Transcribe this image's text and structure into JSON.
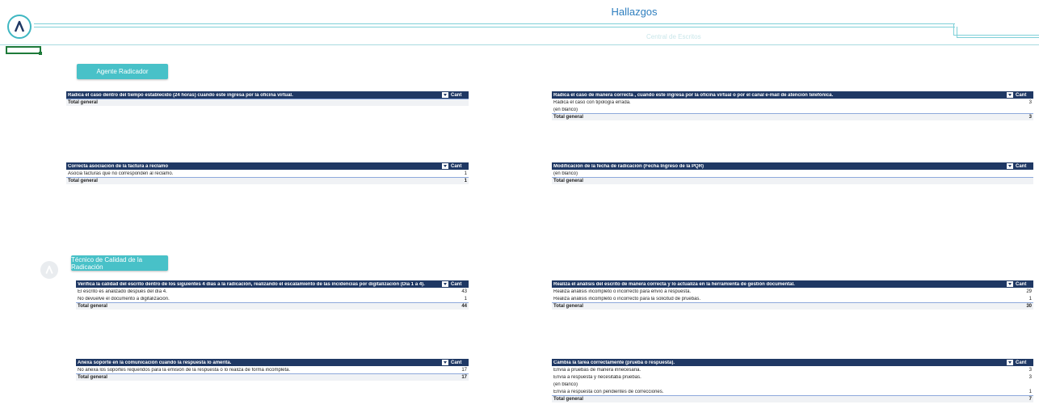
{
  "header": {
    "title": "Hallazgos",
    "subtitle": "Central de Escritos"
  },
  "sections": {
    "agente": "Agente Radicador",
    "tecnico": "Técnico de Calidad de la Radicación"
  },
  "tables": [
    {
      "header": "Radica el caso dentro del tiempo establecido (24 horas) cuando este ingresa por la oficina virtual.",
      "count_label": "Cant",
      "rows": [],
      "total_label": "Total general",
      "total": ""
    },
    {
      "header": "Radica el caso de manera correcta , cuando este ingresa por la oficina virtual o por el canal e-mail de atención telefónica.",
      "count_label": "Cant",
      "rows": [
        {
          "label": "Radica el caso con tipología errada.",
          "value": "3"
        },
        {
          "label": "(en blanco)",
          "value": ""
        }
      ],
      "total_label": "Total general",
      "total": "3"
    },
    {
      "header": "Correcta asociación de la factura a reclamo",
      "count_label": "Cant",
      "rows": [
        {
          "label": "Asocia facturas que no corresponden al reclamo.",
          "value": "1"
        }
      ],
      "total_label": "Total general",
      "total": "1"
    },
    {
      "header": "Modificación de la fecha de radicación (Fecha Ingreso de la PQR)",
      "count_label": "Cant",
      "rows": [
        {
          "label": "(en blanco)",
          "value": ""
        }
      ],
      "total_label": "Total general",
      "total": ""
    },
    {
      "header": "Verifica la calidad del escrito dentro de los siguientes 4 días a la radicación, realizando el escalamiento de las incidencias por digitalización (Día 1 a 4).",
      "count_label": "Cant",
      "rows": [
        {
          "label": "El escrito es analizado después del día 4.",
          "value": "43"
        },
        {
          "label": "No devuelve el documento a digitalización.",
          "value": "1"
        }
      ],
      "total_label": "Total general",
      "total": "44"
    },
    {
      "header": "Realiza el análisis del escrito de manera correcta y lo actualiza en la herramienta de gestión documental.",
      "count_label": "Cant",
      "rows": [
        {
          "label": "Realiza análisis incompleto o incorrecto para envío a respuesta.",
          "value": "29"
        },
        {
          "label": "Realiza análisis incompleto o incorrecto para la solicitud de pruebas.",
          "value": "1"
        }
      ],
      "total_label": "Total general",
      "total": "30"
    },
    {
      "header": "Anexa soporte  en la comunicación cuando la respuesta lo amerita.",
      "count_label": "Cant",
      "rows": [
        {
          "label": "No anexa los soportes requeridos para la emisión de la respuesta o lo realiza de forma incompleta.",
          "value": "17"
        }
      ],
      "total_label": "Total general",
      "total": "17"
    },
    {
      "header": "Cambia la tarea correctamente (prueba o respuesta).",
      "count_label": "Cant",
      "rows": [
        {
          "label": "Envía a pruebas de manera innecesaria.",
          "value": "3"
        },
        {
          "label": "Envía a respuesta y necesitaba pruebas.",
          "value": "3"
        },
        {
          "label": "(en blanco)",
          "value": ""
        },
        {
          "label": "Envía a respuesta con pendientes de correcciones.",
          "value": "1"
        }
      ],
      "total_label": "Total general",
      "total": "7"
    }
  ],
  "icons": {
    "logo": "brand-logo-icon",
    "dropdown": "filter-dropdown-icon"
  },
  "colors": {
    "accent": "#48c1c8",
    "table_header": "#1f3864",
    "title": "#2f7fbf"
  }
}
